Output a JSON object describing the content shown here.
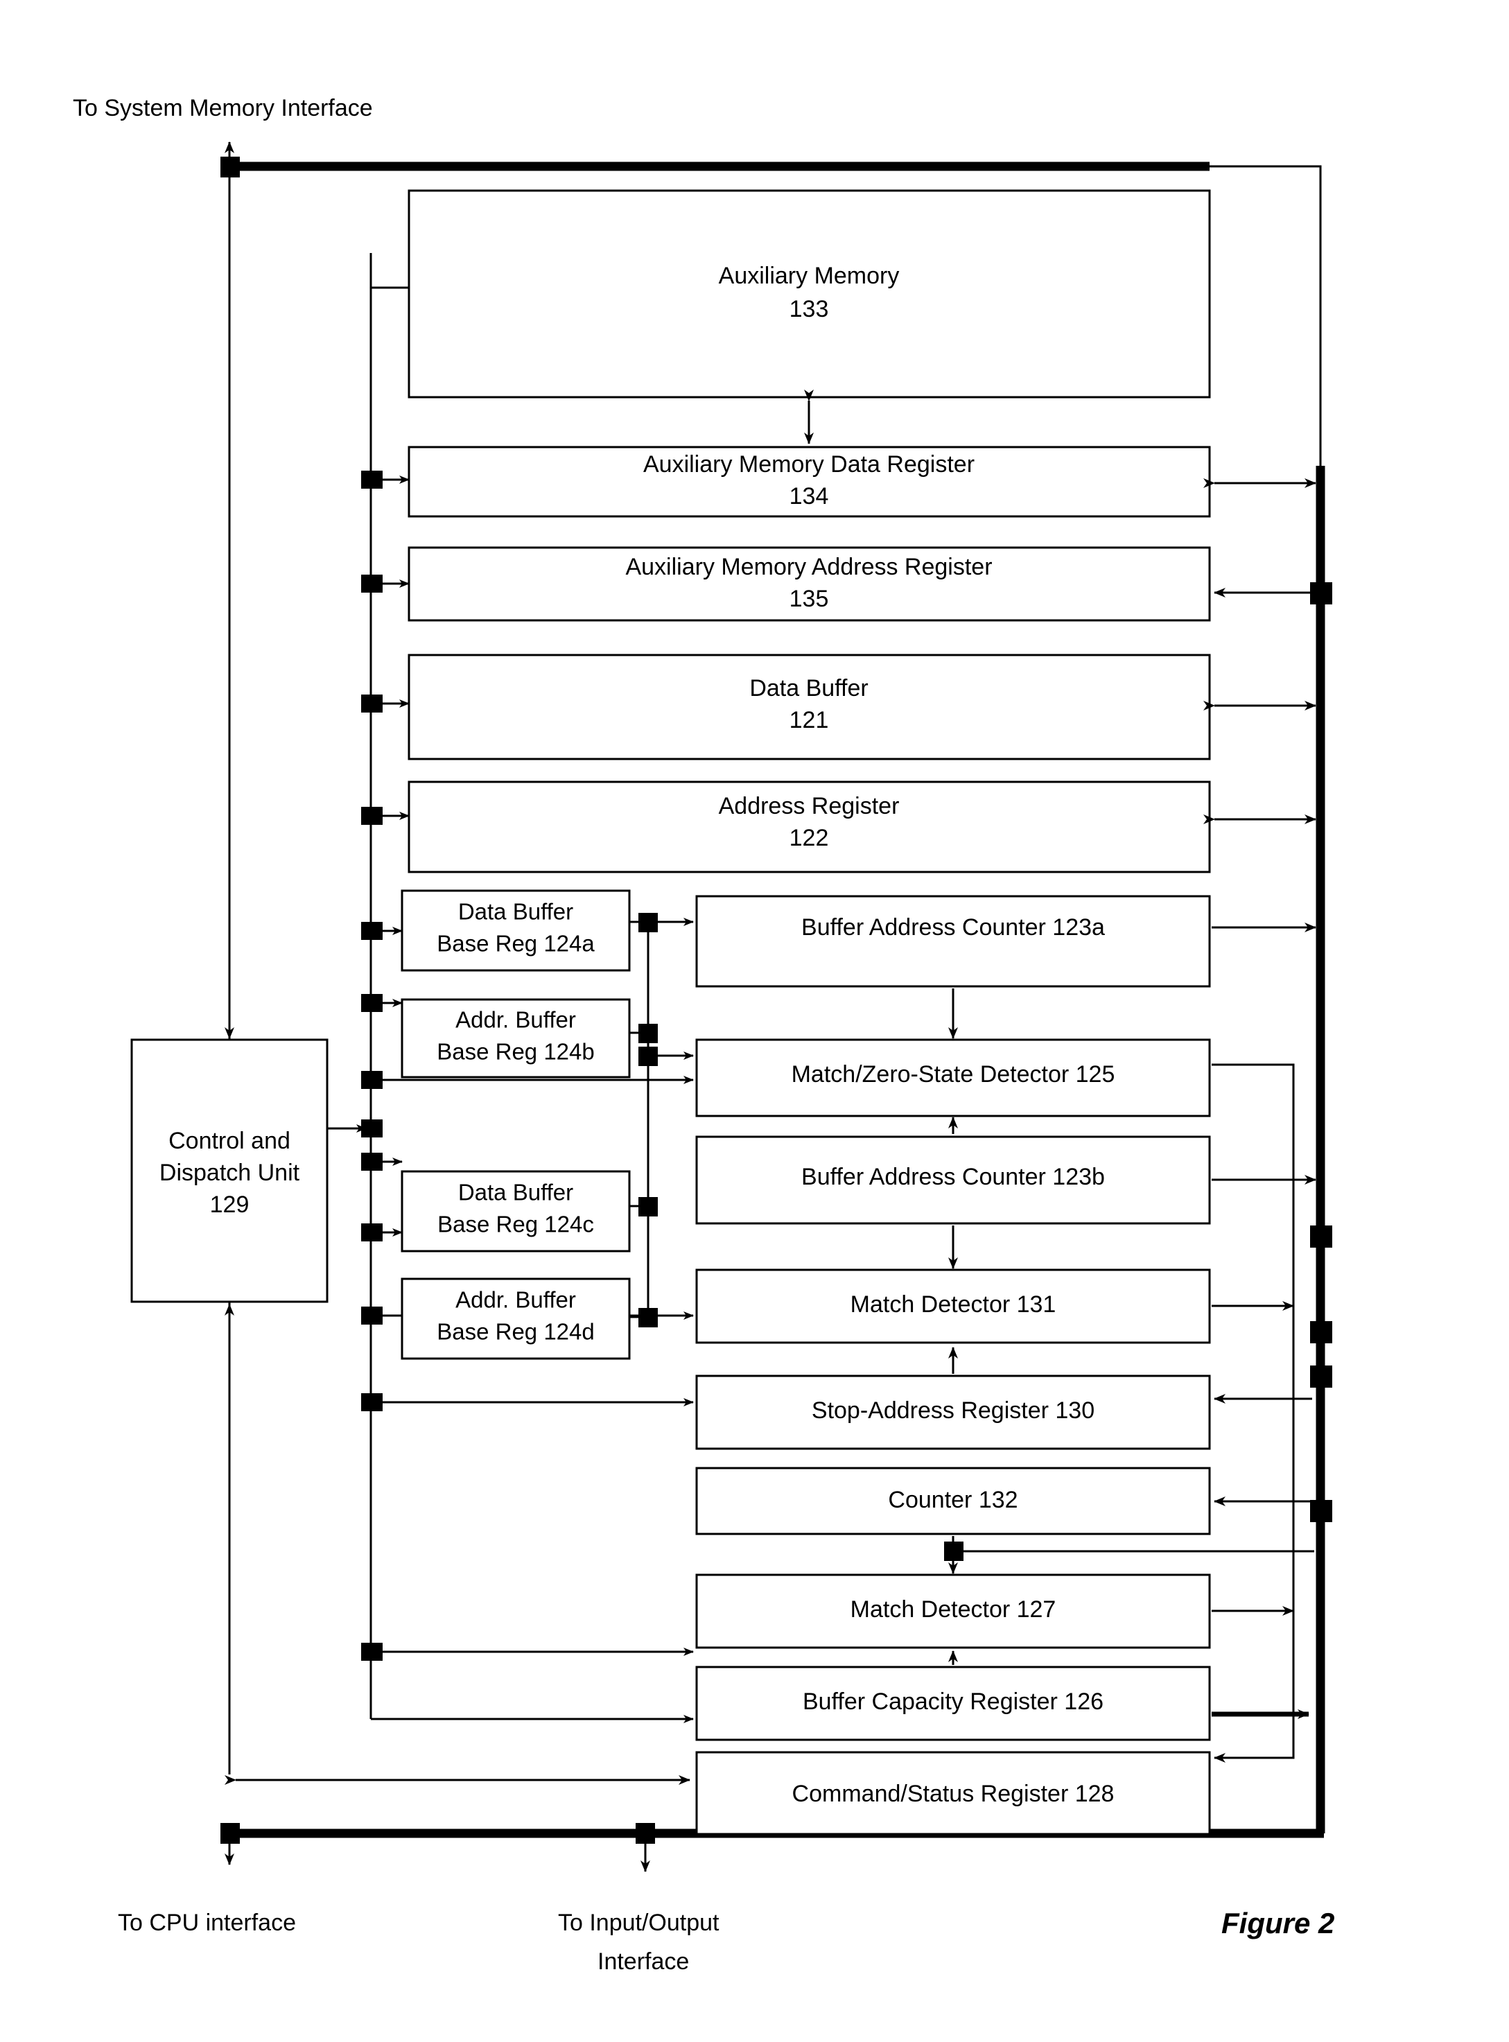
{
  "figure": {
    "caption": "Figure 2",
    "external_labels": {
      "top": "To System Memory Interface",
      "bottom_left": "To CPU interface",
      "bottom_mid_line1": "To Input/Output",
      "bottom_mid_line2": "Interface"
    }
  },
  "blocks": {
    "aux_memory": {
      "title": "Auxiliary Memory",
      "ref": "133"
    },
    "aux_mem_data_reg": {
      "title": "Auxiliary Memory Data Register",
      "ref": "134"
    },
    "aux_mem_addr_reg": {
      "title": "Auxiliary Memory Address Register",
      "ref": "135"
    },
    "data_buffer": {
      "title": "Data Buffer",
      "ref": "121"
    },
    "address_register": {
      "title": "Address Register",
      "ref": "122"
    },
    "data_buffer_base_reg_a": {
      "line1": "Data Buffer",
      "line2": "Base Reg 124a"
    },
    "addr_buffer_base_reg_b": {
      "line1": "Addr.  Buffer",
      "line2": "Base Reg 124b"
    },
    "data_buffer_base_reg_c": {
      "line1": "Data Buffer",
      "line2": "Base Reg 124c"
    },
    "addr_buffer_base_reg_d": {
      "line1": "Addr.  Buffer",
      "line2": "Base Reg 124d"
    },
    "buffer_address_counter_a": {
      "title": "Buffer Address Counter 123a"
    },
    "match_zero_state_detector": {
      "title": "Match/Zero-State Detector 125"
    },
    "buffer_address_counter_b": {
      "title": "Buffer Address Counter  123b"
    },
    "match_detector_131": {
      "title": "Match Detector 131"
    },
    "stop_address_register": {
      "title": "Stop-Address Register 130"
    },
    "counter_132": {
      "title": "Counter 132"
    },
    "match_detector_127": {
      "title": "Match Detector 127"
    },
    "buffer_capacity_register": {
      "title": "Buffer Capacity Register 126"
    },
    "command_status_register": {
      "title": "Command/Status Register 128"
    },
    "control_dispatch_unit": {
      "line1": "Control and",
      "line2": "Dispatch Unit",
      "line3": "129"
    }
  },
  "colors": {
    "stroke": "#000000",
    "fill": "#ffffff"
  }
}
